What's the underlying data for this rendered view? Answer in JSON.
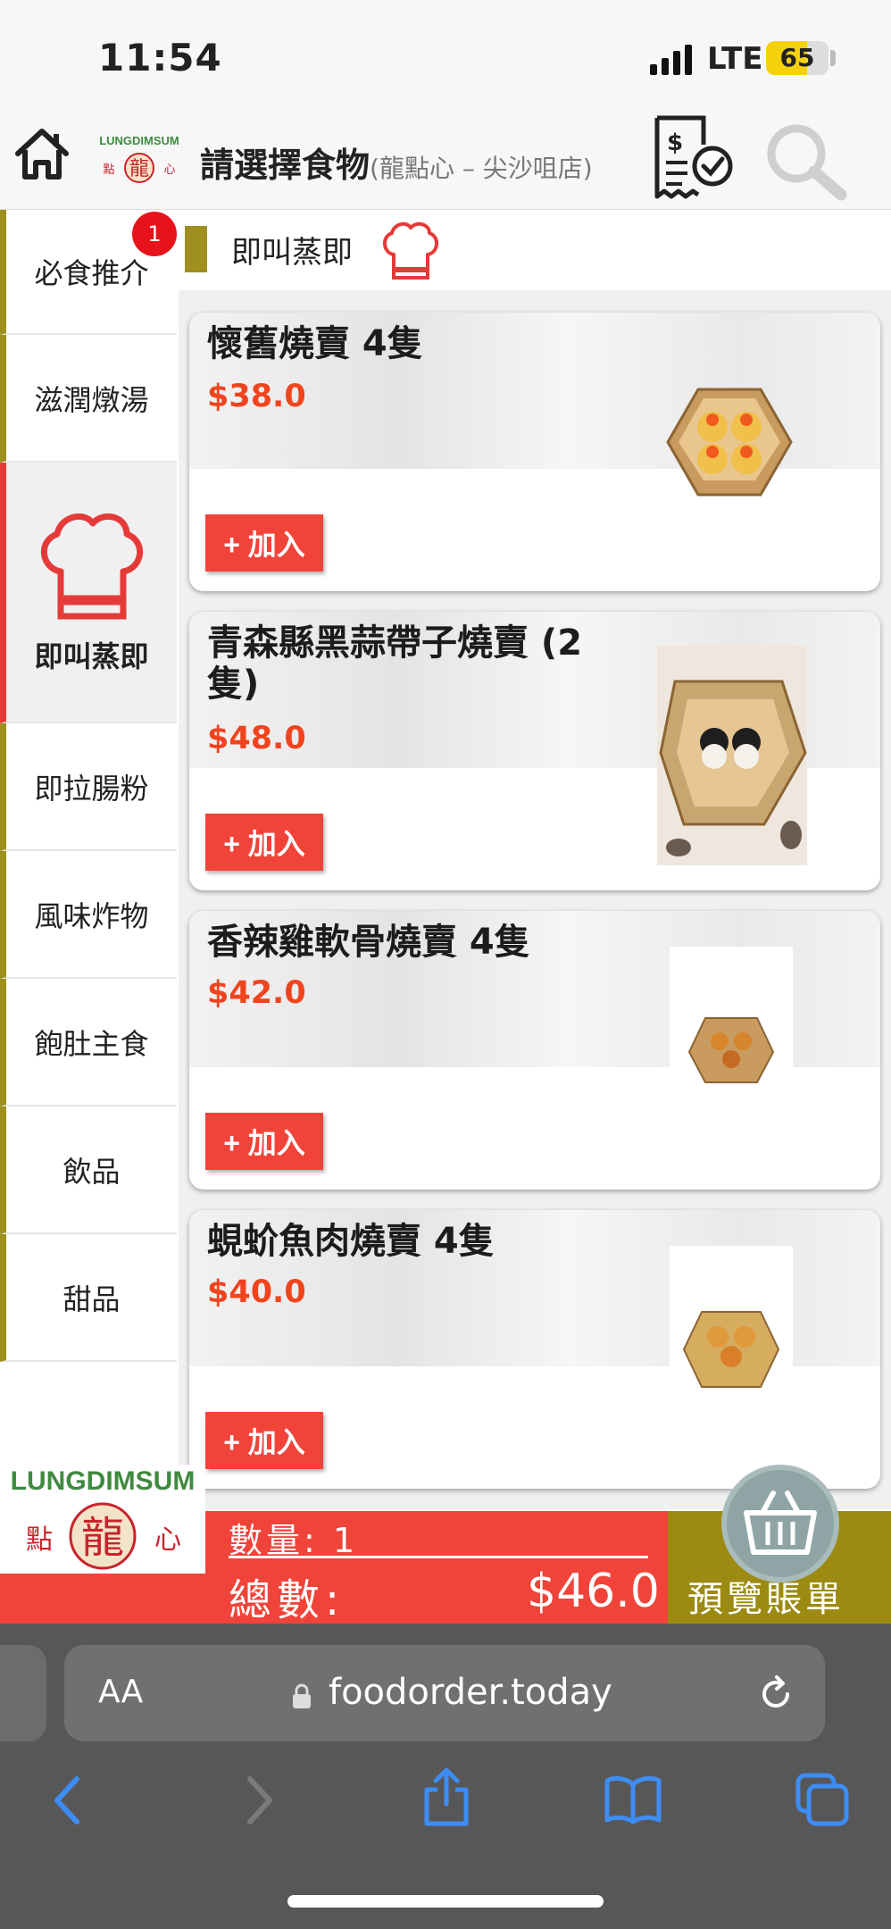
{
  "status_bar": {
    "time": "11:54",
    "network": "LTE",
    "battery": "65"
  },
  "header": {
    "title": "請選擇食物",
    "subtitle": "(龍點心 – 尖沙咀店)",
    "logo_text": "LUNGDIMSUM",
    "logo_cn": "點龍心"
  },
  "sidebar": {
    "items": [
      {
        "label": "必食推介",
        "badge": "1"
      },
      {
        "label": "滋潤燉湯"
      },
      {
        "label": "即叫蒸即",
        "active": true
      },
      {
        "label": "即拉腸粉"
      },
      {
        "label": "風味炸物"
      },
      {
        "label": "飽肚主食"
      },
      {
        "label": "飲品"
      },
      {
        "label": "甜品"
      }
    ]
  },
  "section": {
    "title": "即叫蒸即"
  },
  "products": [
    {
      "name": "懷舊燒賣 4隻",
      "price": "$38.0",
      "add": "+ 加入"
    },
    {
      "name": "青森縣黑蒜帶子燒賣 (2隻)",
      "price": "$48.0",
      "add": "+ 加入"
    },
    {
      "name": "香辣雞軟骨燒賣 4隻",
      "price": "$42.0",
      "add": "+ 加入"
    },
    {
      "name": "蜆蚧魚肉燒賣 4隻",
      "price": "$40.0",
      "add": "+ 加入"
    }
  ],
  "cart": {
    "quantity": "數量: 1",
    "total_label": "總數:",
    "total_value": "$46.0",
    "preview_label": "預覽賬單"
  },
  "browser": {
    "text_size": "AA",
    "url": "foodorder.today"
  },
  "colors": {
    "accent_red": "#f0443a",
    "olive": "#9e8f1f",
    "price_orange": "#f0441e"
  }
}
